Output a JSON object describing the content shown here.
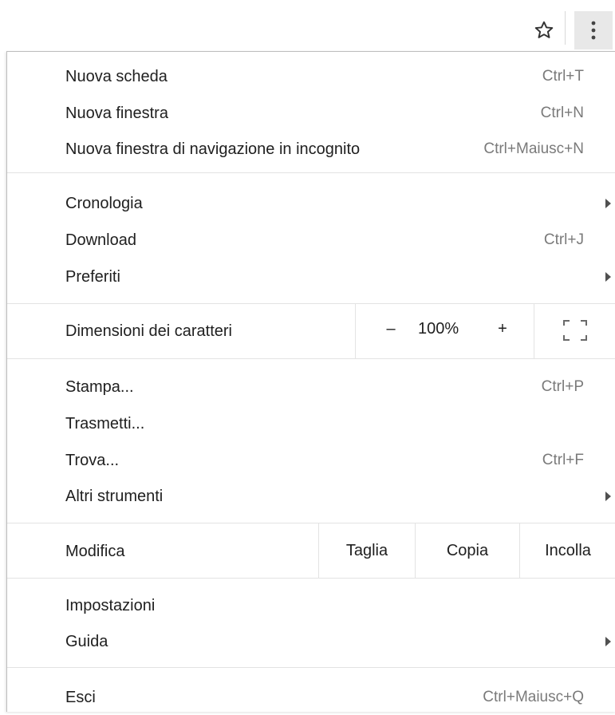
{
  "toolbar": {
    "bookmark_icon": "star-outline-icon",
    "menu_icon": "three-dots-vertical-icon"
  },
  "menu": {
    "group1": [
      {
        "label": "Nuova scheda",
        "shortcut": "Ctrl+T"
      },
      {
        "label": "Nuova finestra",
        "shortcut": "Ctrl+N"
      },
      {
        "label": "Nuova finestra di navigazione in incognito",
        "shortcut": "Ctrl+Maiusc+N"
      }
    ],
    "group2": [
      {
        "label": "Cronologia",
        "has_submenu": true
      },
      {
        "label": "Download",
        "shortcut": "Ctrl+J"
      },
      {
        "label": "Preferiti",
        "has_submenu": true
      }
    ],
    "zoom": {
      "label": "Dimensioni dei caratteri",
      "minus": "–",
      "value": "100%",
      "plus": "+",
      "fullscreen_icon": "fullscreen-icon"
    },
    "group3": [
      {
        "label": "Stampa...",
        "shortcut": "Ctrl+P"
      },
      {
        "label": "Trasmetti..."
      },
      {
        "label": "Trova...",
        "shortcut": "Ctrl+F"
      },
      {
        "label": "Altri strumenti",
        "has_submenu": true
      }
    ],
    "edit": {
      "label": "Modifica",
      "cut": "Taglia",
      "copy": "Copia",
      "paste": "Incolla"
    },
    "group4": [
      {
        "label": "Impostazioni"
      },
      {
        "label": "Guida",
        "has_submenu": true
      }
    ],
    "exit": {
      "label": "Esci",
      "shortcut": "Ctrl+Maiusc+Q"
    }
  }
}
